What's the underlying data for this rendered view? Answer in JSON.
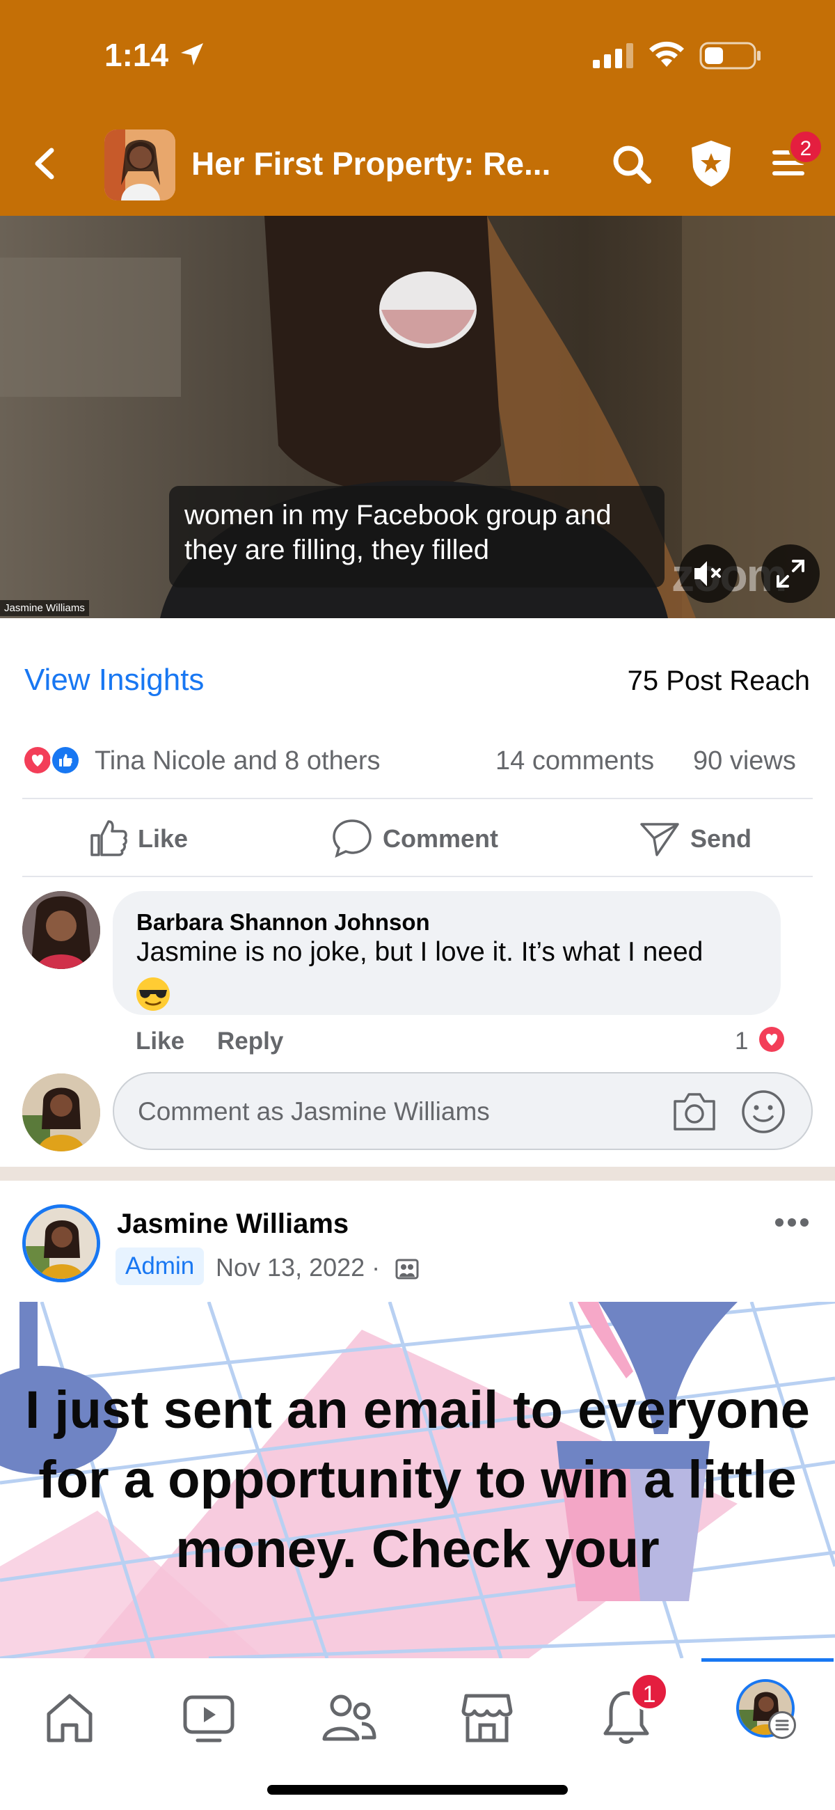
{
  "status_bar": {
    "time": "1:14"
  },
  "header": {
    "group_title": "Her First Property: Re...",
    "menu_badge": "2"
  },
  "video": {
    "caption_line1": "women in my Facebook group and",
    "caption_line2": "they are filling, they filled",
    "speaker_label": "Jasmine Williams",
    "watermark": "zoom"
  },
  "insights": {
    "view_insights": "View Insights",
    "post_reach": "75 Post Reach"
  },
  "reactions": {
    "text": "Tina Nicole and 8 others",
    "comments": "14 comments",
    "views": "90 views"
  },
  "actions": {
    "like": "Like",
    "comment": "Comment",
    "send": "Send"
  },
  "comment": {
    "author": "Barbara Shannon Johnson",
    "text": "Jasmine is no joke, but I love it. It’s what I need",
    "like": "Like",
    "reply": "Reply",
    "reaction_count": "1"
  },
  "comment_input": {
    "placeholder": "Comment as Jasmine Williams"
  },
  "post2": {
    "author": "Jasmine Williams",
    "badge": "Admin",
    "date": "Nov 13, 2022 ·",
    "image_text": "I just sent an email to everyone for a opportunity to win a little money. Check your"
  },
  "bottom_nav": {
    "notification_badge": "1"
  },
  "colors": {
    "header_bg": "#C46F06",
    "accent_blue": "#1877F2",
    "badge_red": "#E41E3F",
    "secondary_text": "#65676B"
  },
  "icons": [
    "location-arrow-icon",
    "signal-icon",
    "wifi-icon",
    "battery-icon",
    "back-chevron-icon",
    "search-icon",
    "admin-shield-icon",
    "hamburger-menu-icon",
    "mute-icon",
    "expand-icon",
    "love-reaction-icon",
    "like-reaction-icon",
    "thumbs-up-icon",
    "comment-bubble-icon",
    "send-icon",
    "sunglasses-emoji-icon",
    "heart-icon",
    "camera-icon",
    "smiley-icon",
    "more-dots-icon",
    "group-post-icon",
    "home-icon",
    "video-icon",
    "friends-icon",
    "marketplace-icon",
    "bell-icon"
  ]
}
